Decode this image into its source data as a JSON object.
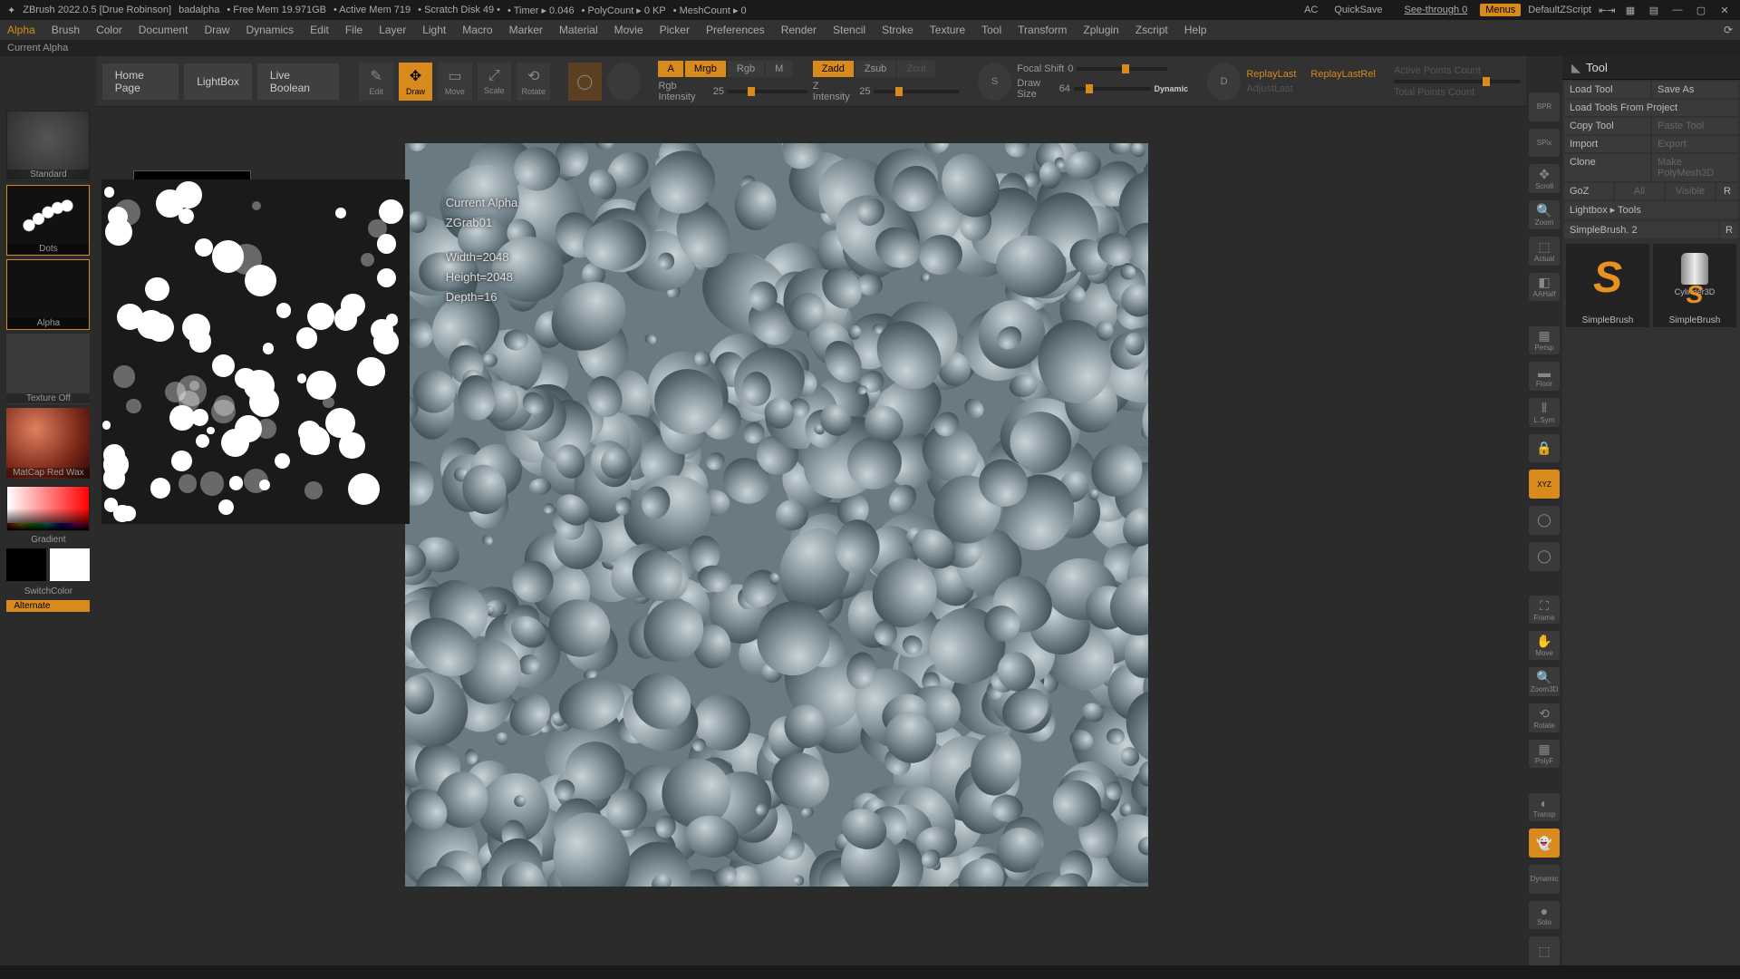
{
  "title": {
    "app": "ZBrush 2022.0.5 [Drue Robinson]",
    "doc": "badalpha",
    "freemem": "• Free Mem 19.971GB",
    "activemem": "• Active Mem 719",
    "scratch": "• Scratch Disk 49 •",
    "timer": "• Timer ▸ 0.046",
    "poly": "• PolyCount ▸ 0 KP",
    "mesh": "• MeshCount ▸ 0",
    "ac": "AC",
    "quicksave": "QuickSave",
    "seethrough": "See-through  0",
    "menus": "Menus",
    "zscript": "DefaultZScript"
  },
  "menu": [
    "Alpha",
    "Brush",
    "Color",
    "Document",
    "Draw",
    "Dynamics",
    "Edit",
    "File",
    "Layer",
    "Light",
    "Macro",
    "Marker",
    "Material",
    "Movie",
    "Picker",
    "Preferences",
    "Render",
    "Stencil",
    "Stroke",
    "Texture",
    "Tool",
    "Transform",
    "Zplugin",
    "Zscript",
    "Help"
  ],
  "status": "Current Alpha",
  "tabs": {
    "home": "Home Page",
    "lightbox": "LightBox",
    "liveboolean": "Live Boolean"
  },
  "modes": {
    "edit": "Edit",
    "draw": "Draw",
    "move": "Move",
    "scale": "Scale",
    "rotate": "Rotate"
  },
  "chips": {
    "a": "A",
    "mrgb": "Mrgb",
    "rgb": "Rgb",
    "m": "M",
    "zadd": "Zadd",
    "zsub": "Zsub",
    "zcut": "Zcut"
  },
  "sliders": {
    "rgb": {
      "label": "Rgb Intensity",
      "value": "25"
    },
    "zint": {
      "label": "Z Intensity",
      "value": "25"
    },
    "focal": {
      "label": "Focal Shift",
      "value": "0"
    },
    "drawsize": {
      "label": "Draw Size",
      "value": "64",
      "dynamic": "Dynamic"
    }
  },
  "replay": {
    "last": "ReplayLast",
    "rel": "ReplayLastRel",
    "adjust": "AdjustLast",
    "active": "Active Points Count",
    "total": "Total Points Count"
  },
  "left": {
    "brush": "Standard",
    "stroke": "Dots",
    "alpha": "Alpha",
    "texture": "Texture Off",
    "matcap": "MatCap Red Wax",
    "gradient": "Gradient",
    "switch": "SwitchColor",
    "alternate": "Alternate"
  },
  "alphainfo": {
    "title": "Current Alpha",
    "name": "ZGrab01",
    "width": "Width=2048",
    "height": "Height=2048",
    "depth": "Depth=16"
  },
  "rvert": [
    "BPR",
    "SPix",
    "Scroll",
    "Zoom",
    "Actual",
    "AAHalf",
    "Persp",
    "Floor",
    "L.Sym",
    "Local",
    "XYZ",
    "",
    "",
    "Frame",
    "Move",
    "Zoom3D",
    "Rotate",
    "PolyF",
    "Transp",
    "Ghost",
    "Dynamic",
    "Solo",
    ""
  ],
  "tool": {
    "header": "Tool",
    "load": "Load Tool",
    "saveas": "Save As",
    "loadproj": "Load Tools From Project",
    "copy": "Copy Tool",
    "paste": "Paste Tool",
    "import": "Import",
    "export": "Export",
    "clone": "Clone",
    "poly": "Make PolyMesh3D",
    "goz": "GoZ",
    "all": "All",
    "visible": "Visible",
    "r": "R",
    "lightbox": "Lightbox ▸ Tools",
    "brushname": "SimpleBrush.",
    "brushnum": "2",
    "r2": "R",
    "thumb1": "SimpleBrush",
    "thumb2": "SimpleBrush",
    "cyl": "Cylinder3D"
  }
}
